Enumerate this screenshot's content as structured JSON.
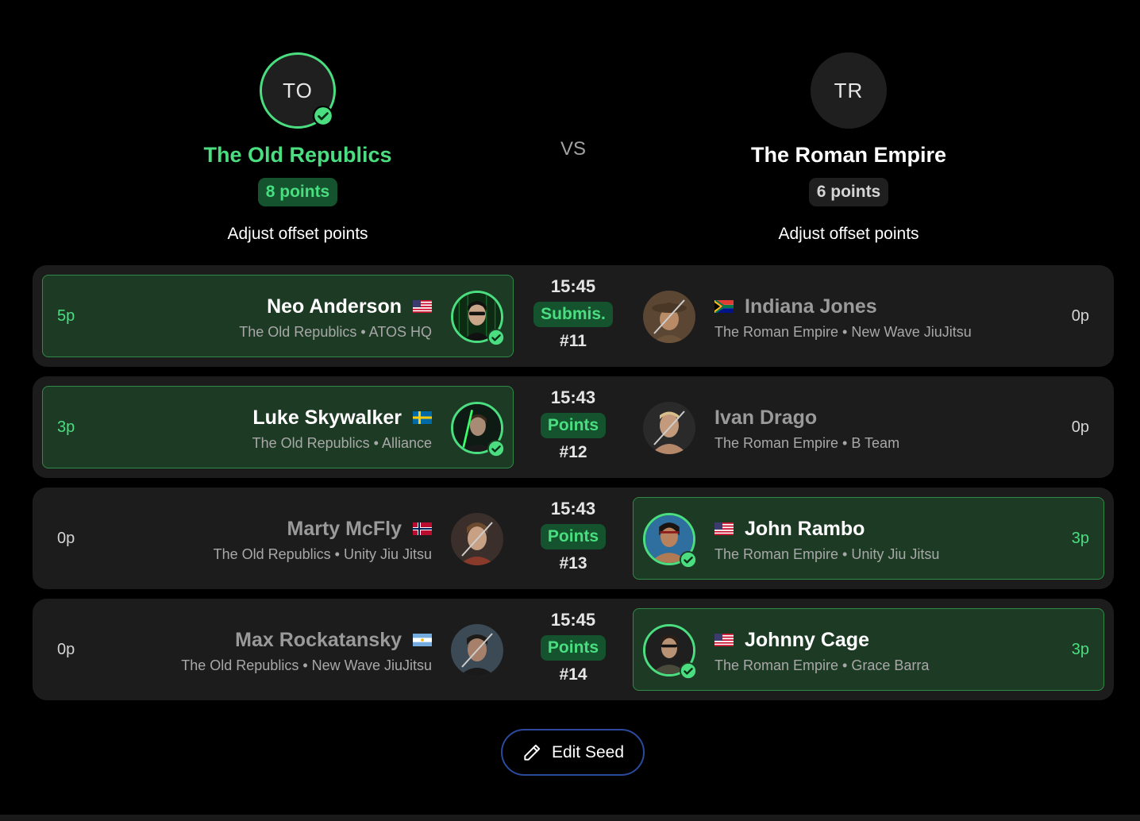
{
  "header": {
    "vs_label": "VS",
    "left_team": {
      "initials": "TO",
      "name": "The Old Republics",
      "points": "8 points",
      "adjust_label": "Adjust offset points",
      "winner": true
    },
    "right_team": {
      "initials": "TR",
      "name": "The Roman Empire",
      "points": "6 points",
      "adjust_label": "Adjust offset points",
      "winner": false
    }
  },
  "colors": {
    "accent": "#4ade80",
    "win_bg": "#1d3a24",
    "row_bg": "#1c1c1c",
    "button_border": "#2b4a9e"
  },
  "matches": [
    {
      "time": "15:45",
      "method": "Submis.",
      "number": "#11",
      "left": {
        "name": "Neo Anderson",
        "flag": "us-flag-icon",
        "subtitle": "The Old Republics • ATOS HQ",
        "points": "5p",
        "winner": true
      },
      "right": {
        "name": "Indiana Jones",
        "flag": "za-flag-icon",
        "subtitle": "The Roman Empire • New Wave JiuJitsu",
        "points": "0p",
        "winner": false
      }
    },
    {
      "time": "15:43",
      "method": "Points",
      "number": "#12",
      "left": {
        "name": "Luke Skywalker",
        "flag": "se-flag-icon",
        "subtitle": "The Old Republics • Alliance",
        "points": "3p",
        "winner": true
      },
      "right": {
        "name": "Ivan Drago",
        "flag": "",
        "subtitle": "The Roman Empire • B Team",
        "points": "0p",
        "winner": false
      }
    },
    {
      "time": "15:43",
      "method": "Points",
      "number": "#13",
      "left": {
        "name": "Marty McFly",
        "flag": "no-flag-icon",
        "subtitle": "The Old Republics • Unity Jiu Jitsu",
        "points": "0p",
        "winner": false
      },
      "right": {
        "name": "John Rambo",
        "flag": "us-flag-icon",
        "subtitle": "The Roman Empire • Unity Jiu Jitsu",
        "points": "3p",
        "winner": true
      }
    },
    {
      "time": "15:45",
      "method": "Points",
      "number": "#14",
      "left": {
        "name": "Max Rockatansky",
        "flag": "ar-flag-icon",
        "subtitle": "The Old Republics • New Wave JiuJitsu",
        "points": "0p",
        "winner": false
      },
      "right": {
        "name": "Johnny Cage",
        "flag": "us-flag-icon",
        "subtitle": "The Roman Empire • Grace Barra",
        "points": "3p",
        "winner": true
      }
    }
  ],
  "actions": {
    "edit_seed_label": "Edit Seed",
    "edit_icon": "pencil-icon"
  }
}
